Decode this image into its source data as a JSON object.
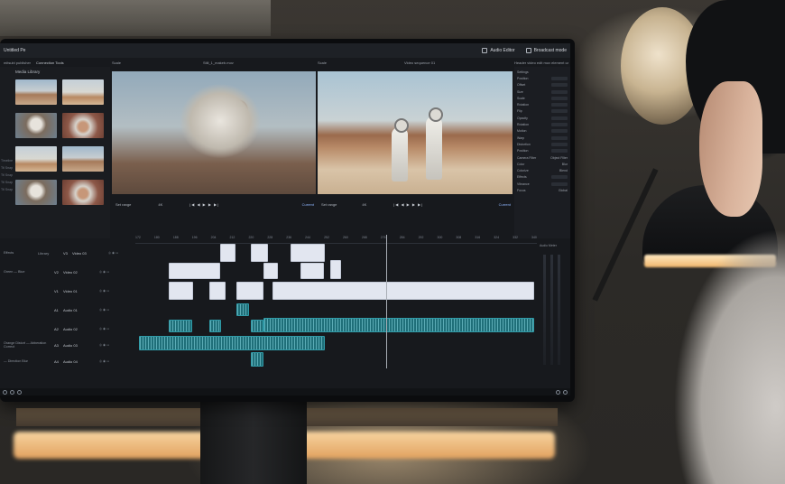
{
  "window": {
    "app_title": "Untitled Pe",
    "audio_editor_label": "Audio Editor",
    "broadcast_mode_label": "Broadcast mode"
  },
  "subbar": {
    "project": "mitsubi publisher",
    "tool": "Connection Tools",
    "left_viewer_mode": "Scale",
    "left_viewer_title": "Still_1_makeb.mov",
    "right_viewer_mode": "Scale",
    "right_viewer_title": "Video sequence 01",
    "inspector_tabs": "Header video edit mov element carbon"
  },
  "media_library": {
    "title": "Media Library",
    "thumbnails": [
      "desert-wide",
      "astronaut-walk",
      "suit-closeup",
      "helmet-face",
      "desert-walk",
      "crater-scene",
      "astronaut-stand",
      "helmet-portrait"
    ]
  },
  "left_side_list": [
    "Timeline",
    "Ttl Snap",
    "Ttl Snap",
    "Ttl Snap",
    "Ttl Snap"
  ],
  "transport": {
    "left_range": "Set range",
    "left_res": "4K",
    "left_current": "Current",
    "right_range": "Set range",
    "right_res": "4K",
    "right_current": "Current"
  },
  "inspector": {
    "header": "Settings",
    "rows": [
      "Position",
      "Offset",
      "Size",
      "Scale",
      "Rotation",
      "Flip",
      "Opacity",
      "Rotation",
      "Motion",
      "Warp",
      "Distortion",
      "Position",
      "Camera Filter",
      "Color",
      "Colorize",
      "Find tree",
      "Shadow",
      "Blend",
      "Stretch",
      "Noise"
    ],
    "right_rows": [
      "Object Filter",
      "Blur",
      "Blend",
      "Global"
    ],
    "text_rows": [
      "Effects",
      "Vibrance",
      "Focus",
      "Blend",
      "Motion"
    ]
  },
  "timeline": {
    "ruler_ticks": [
      "172",
      "180",
      "188",
      "196",
      "204",
      "212",
      "220",
      "228",
      "236",
      "244",
      "252",
      "260",
      "268",
      "276",
      "284",
      "292",
      "300",
      "308",
      "316",
      "324",
      "332",
      "340"
    ],
    "panel_tabs": [
      "Effects",
      "Library"
    ],
    "tracks": [
      {
        "side": "",
        "id": "V3",
        "name": "Video 03"
      },
      {
        "side": "Green — Blue",
        "id": "V2",
        "name": "Video 02"
      },
      {
        "side": "",
        "id": "V1",
        "name": "Video 01"
      },
      {
        "side": "",
        "id": "A1",
        "name": "Audio 01"
      },
      {
        "side": "",
        "id": "A2",
        "name": "Audio 02"
      },
      {
        "side": "Orange Distort — Abberation Correct",
        "id": "A3",
        "name": "Audio 03"
      },
      {
        "side": "",
        "id": "A4",
        "name": "Audio 04"
      },
      {
        "side": "— Direction Blur",
        "id": "A4",
        "name": "Audio 04"
      }
    ],
    "audio_meter_label": "Audio Meter"
  },
  "colors": {
    "video_clip": "#e2e6f0",
    "audio_clip": "#1f6f79",
    "panel_bg": "#17191d",
    "accent_link": "#8fb6ff"
  }
}
